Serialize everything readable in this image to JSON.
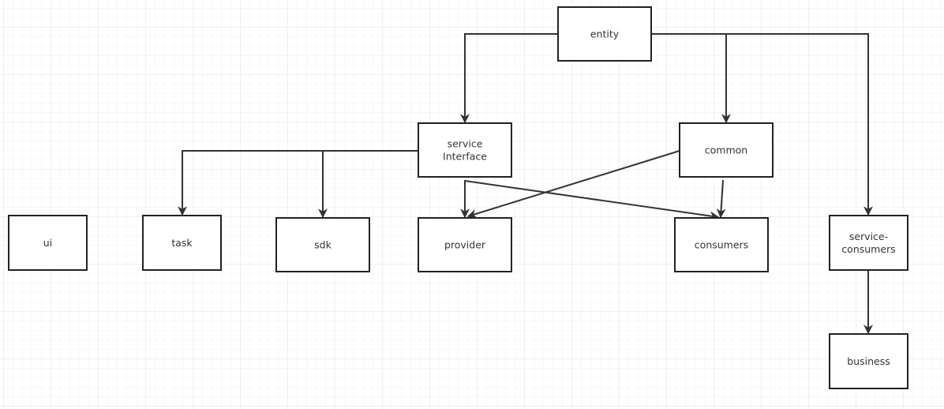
{
  "diagram": {
    "nodes": [
      {
        "id": "entity",
        "lines": [
          "entity"
        ]
      },
      {
        "id": "service-interface",
        "lines": [
          "service",
          "Interface"
        ]
      },
      {
        "id": "common",
        "lines": [
          "common"
        ]
      },
      {
        "id": "ui",
        "lines": [
          "ui"
        ]
      },
      {
        "id": "task",
        "lines": [
          "task"
        ]
      },
      {
        "id": "sdk",
        "lines": [
          "sdk"
        ]
      },
      {
        "id": "provider",
        "lines": [
          "provider"
        ]
      },
      {
        "id": "consumers",
        "lines": [
          "consumers"
        ]
      },
      {
        "id": "service-consumers",
        "lines": [
          "service-",
          "consumers"
        ]
      },
      {
        "id": "business",
        "lines": [
          "business"
        ]
      }
    ],
    "edges": [
      {
        "from": "entity",
        "to": "service-interface"
      },
      {
        "from": "entity",
        "to": "common"
      },
      {
        "from": "entity",
        "to": "service-consumers"
      },
      {
        "from": "service-interface",
        "to": "task"
      },
      {
        "from": "service-interface",
        "to": "sdk"
      },
      {
        "from": "service-interface",
        "to": "provider"
      },
      {
        "from": "service-interface",
        "to": "consumers"
      },
      {
        "from": "common",
        "to": "provider"
      },
      {
        "from": "common",
        "to": "consumers"
      },
      {
        "from": "service-consumers",
        "to": "business"
      }
    ],
    "colors": {
      "stroke": "#222222",
      "grid": "#e6e6e6",
      "text": "#333333"
    }
  }
}
